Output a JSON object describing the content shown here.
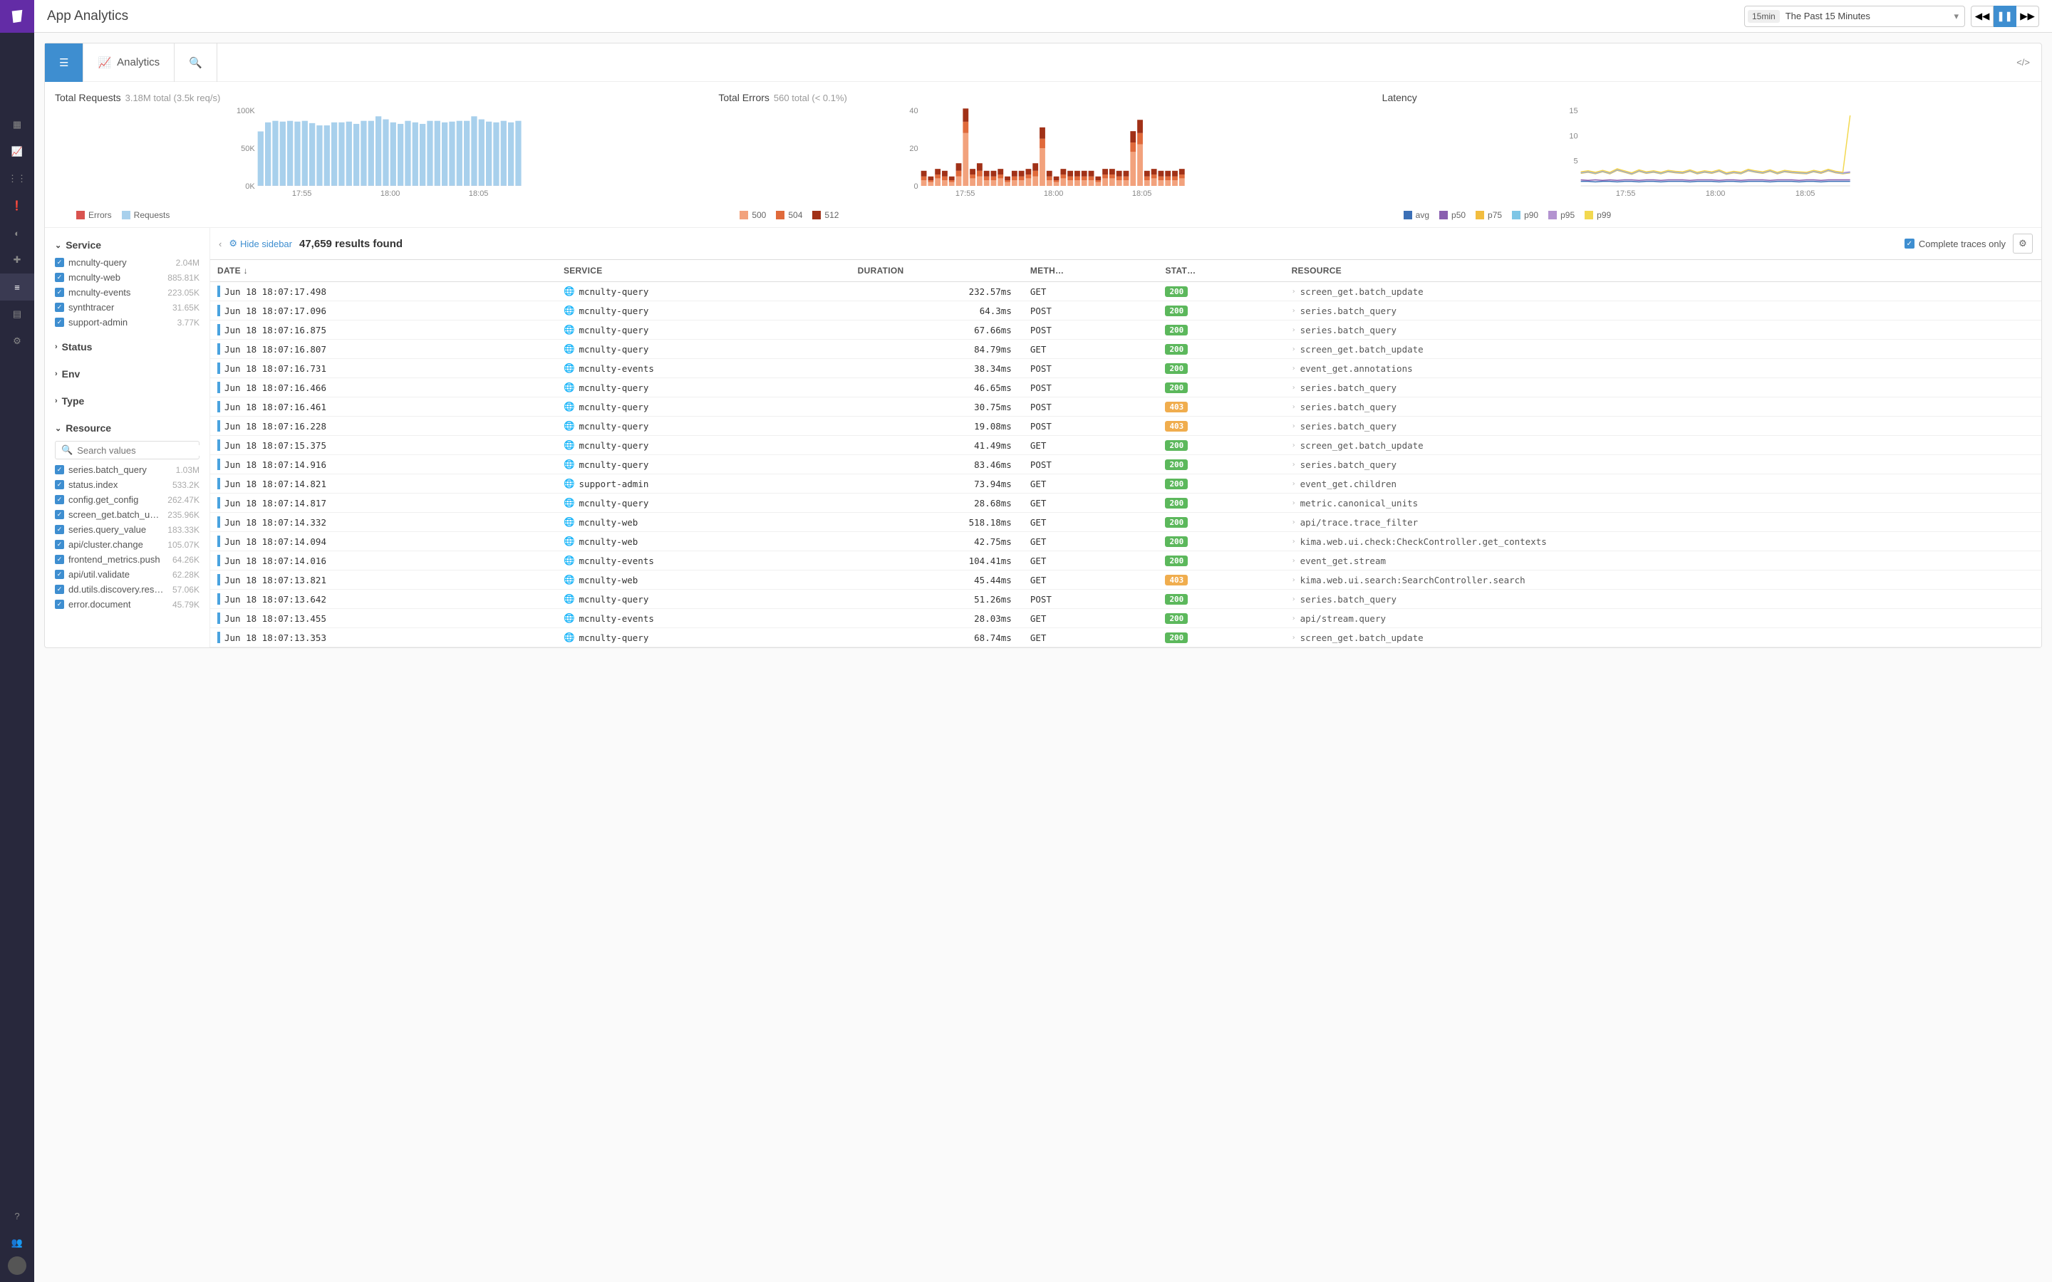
{
  "header": {
    "title": "App Analytics",
    "timerange_badge": "15min",
    "timerange_label": "The Past 15 Minutes"
  },
  "toolbar": {
    "analytics_label": "Analytics"
  },
  "chart_data": [
    {
      "type": "bar",
      "title": "Total Requests",
      "subtitle": "3.18M total (3.5k req/s)",
      "ylabel": "",
      "ylim": [
        0,
        100000
      ],
      "yticks": [
        0,
        50000,
        100000
      ],
      "ytick_labels": [
        "0K",
        "50K",
        "100K"
      ],
      "xticks": [
        "17:55",
        "18:00",
        "18:05"
      ],
      "series": [
        {
          "name": "Errors",
          "color": "#d9534f",
          "values": [
            150,
            140,
            150,
            150,
            140,
            150,
            150,
            140,
            140,
            140,
            150,
            150,
            150,
            140,
            150,
            150,
            160,
            150,
            150,
            140,
            150,
            150,
            140,
            150,
            150,
            140,
            150,
            150,
            150,
            160,
            150,
            150,
            140,
            150,
            150,
            150
          ]
        },
        {
          "name": "Requests",
          "color": "#a8d0ec",
          "values": [
            72000,
            84000,
            86000,
            85000,
            86000,
            85000,
            86000,
            83000,
            80000,
            80000,
            84000,
            84000,
            85000,
            82000,
            86000,
            86000,
            92000,
            88000,
            84000,
            82000,
            86000,
            84000,
            82000,
            86000,
            86000,
            84000,
            85000,
            86000,
            86000,
            92000,
            88000,
            85000,
            84000,
            86000,
            84000,
            86000
          ]
        }
      ],
      "legend": [
        "Errors",
        "Requests"
      ]
    },
    {
      "type": "bar",
      "title": "Total Errors",
      "subtitle": "560 total (< 0.1%)",
      "ylim": [
        0,
        40
      ],
      "yticks": [
        0,
        20,
        40
      ],
      "ytick_labels": [
        "0",
        "20",
        "40"
      ],
      "xticks": [
        "17:55",
        "18:00",
        "18:05"
      ],
      "series": [
        {
          "name": "500",
          "color": "#f2a27d",
          "values": [
            3,
            2,
            4,
            3,
            2,
            5,
            28,
            4,
            5,
            3,
            3,
            4,
            2,
            3,
            3,
            4,
            5,
            20,
            3,
            2,
            4,
            3,
            3,
            3,
            3,
            2,
            4,
            4,
            3,
            3,
            18,
            22,
            3,
            4,
            3,
            3,
            3,
            4
          ]
        },
        {
          "name": "504",
          "color": "#e06a3b",
          "values": [
            2,
            1,
            2,
            2,
            1,
            3,
            6,
            2,
            3,
            2,
            2,
            2,
            1,
            2,
            2,
            2,
            3,
            5,
            2,
            1,
            2,
            2,
            2,
            2,
            2,
            1,
            2,
            2,
            2,
            2,
            5,
            6,
            2,
            2,
            2,
            2,
            2,
            2
          ]
        },
        {
          "name": "512",
          "color": "#a13117",
          "values": [
            3,
            2,
            3,
            3,
            2,
            4,
            7,
            3,
            4,
            3,
            3,
            3,
            2,
            3,
            3,
            3,
            4,
            6,
            3,
            2,
            3,
            3,
            3,
            3,
            3,
            2,
            3,
            3,
            3,
            3,
            6,
            7,
            3,
            3,
            3,
            3,
            3,
            3
          ]
        }
      ],
      "legend": [
        "500",
        "504",
        "512"
      ]
    },
    {
      "type": "line",
      "title": "Latency",
      "subtitle": "",
      "ylim": [
        0,
        15
      ],
      "yticks": [
        5,
        10,
        15
      ],
      "ytick_labels": [
        "5",
        "10",
        "15"
      ],
      "xticks": [
        "17:55",
        "18:00",
        "18:05"
      ],
      "x": [
        0,
        1,
        2,
        3,
        4,
        5,
        6,
        7,
        8,
        9,
        10,
        11,
        12,
        13,
        14,
        15,
        16,
        17,
        18,
        19,
        20,
        21,
        22,
        23,
        24,
        25,
        26,
        27,
        28,
        29,
        30,
        31,
        32,
        33,
        34,
        35,
        36,
        37
      ],
      "series": [
        {
          "name": "avg",
          "color": "#3b6fb6",
          "values": [
            0.9,
            0.9,
            0.8,
            0.9,
            0.9,
            0.8,
            0.9,
            0.9,
            0.8,
            0.9,
            0.9,
            0.8,
            0.9,
            0.9,
            0.9,
            0.8,
            0.9,
            0.9,
            0.9,
            0.8,
            0.9,
            0.9,
            0.8,
            0.9,
            0.9,
            0.9,
            0.8,
            0.9,
            0.9,
            0.9,
            0.8,
            0.9,
            0.9,
            0.8,
            0.9,
            0.9,
            0.9,
            0.9
          ]
        },
        {
          "name": "p50",
          "color": "#8a5fb0",
          "values": [
            1.2,
            1.1,
            1.2,
            1.1,
            1.2,
            1.1,
            1.2,
            1.2,
            1.1,
            1.2,
            1.2,
            1.1,
            1.2,
            1.2,
            1.2,
            1.1,
            1.2,
            1.2,
            1.2,
            1.1,
            1.2,
            1.2,
            1.1,
            1.2,
            1.2,
            1.2,
            1.1,
            1.2,
            1.2,
            1.2,
            1.1,
            1.2,
            1.2,
            1.1,
            1.2,
            1.2,
            1.2,
            1.2
          ]
        },
        {
          "name": "p75",
          "color": "#f2bd3f",
          "values": [
            2.5,
            2.7,
            2.4,
            2.8,
            2.4,
            3.1,
            2.7,
            2.3,
            2.9,
            2.5,
            2.7,
            2.4,
            2.8,
            2.6,
            2.5,
            2.9,
            2.4,
            2.7,
            2.5,
            2.9,
            2.3,
            2.6,
            2.4,
            3.0,
            2.7,
            2.5,
            2.9,
            2.4,
            2.8,
            2.6,
            2.5,
            2.4,
            2.8,
            2.5,
            3.0,
            2.6,
            2.4,
            2.6
          ]
        },
        {
          "name": "p90",
          "color": "#7ec6e6",
          "values": [
            2.6,
            2.8,
            2.5,
            2.9,
            2.5,
            3.2,
            2.8,
            2.4,
            3.0,
            2.6,
            2.8,
            2.5,
            2.9,
            2.7,
            2.6,
            3.0,
            2.5,
            2.8,
            2.6,
            3.0,
            2.4,
            2.7,
            2.5,
            3.1,
            2.8,
            2.6,
            3.0,
            2.5,
            2.9,
            2.7,
            2.6,
            2.5,
            2.9,
            2.6,
            3.1,
            2.7,
            2.5,
            2.7
          ]
        },
        {
          "name": "p95",
          "color": "#b393d0",
          "values": [
            2.7,
            2.9,
            2.6,
            3.0,
            2.6,
            3.3,
            2.9,
            2.5,
            3.1,
            2.7,
            2.9,
            2.6,
            3.0,
            2.8,
            2.7,
            3.1,
            2.6,
            2.9,
            2.7,
            3.1,
            2.5,
            2.8,
            2.6,
            3.2,
            2.9,
            2.7,
            3.1,
            2.6,
            3.0,
            2.8,
            2.7,
            2.6,
            3.0,
            2.7,
            3.2,
            2.8,
            2.6,
            2.8
          ]
        },
        {
          "name": "p99",
          "color": "#f2d84f",
          "values": [
            2.8,
            3.0,
            2.7,
            3.1,
            2.7,
            3.4,
            3.0,
            2.6,
            3.2,
            2.8,
            3.0,
            2.7,
            3.1,
            2.9,
            2.8,
            3.2,
            2.7,
            3.0,
            2.8,
            3.2,
            2.6,
            2.9,
            2.7,
            3.3,
            3.0,
            2.8,
            3.2,
            2.7,
            3.1,
            2.9,
            2.8,
            2.7,
            3.1,
            2.8,
            3.3,
            2.9,
            2.7,
            14.0
          ]
        }
      ],
      "legend": [
        "avg",
        "p50",
        "p75",
        "p90",
        "p95",
        "p99"
      ]
    }
  ],
  "facets": {
    "service": {
      "label": "Service",
      "expanded": true,
      "items": [
        {
          "name": "mcnulty-query",
          "count": "2.04M"
        },
        {
          "name": "mcnulty-web",
          "count": "885.81K"
        },
        {
          "name": "mcnulty-events",
          "count": "223.05K"
        },
        {
          "name": "synthtracer",
          "count": "31.65K"
        },
        {
          "name": "support-admin",
          "count": "3.77K"
        }
      ]
    },
    "status": {
      "label": "Status",
      "expanded": false
    },
    "env": {
      "label": "Env",
      "expanded": false
    },
    "type": {
      "label": "Type",
      "expanded": false
    },
    "resource": {
      "label": "Resource",
      "expanded": true,
      "search_placeholder": "Search values",
      "items": [
        {
          "name": "series.batch_query",
          "count": "1.03M"
        },
        {
          "name": "status.index",
          "count": "533.2K"
        },
        {
          "name": "config.get_config",
          "count": "262.47K"
        },
        {
          "name": "screen_get.batch_update",
          "count": "235.96K"
        },
        {
          "name": "series.query_value",
          "count": "183.33K"
        },
        {
          "name": "api/cluster.change",
          "count": "105.07K"
        },
        {
          "name": "frontend_metrics.push",
          "count": "64.26K"
        },
        {
          "name": "api/util.validate",
          "count": "62.28K"
        },
        {
          "name": "dd.utils.discovery.resolv…",
          "count": "57.06K"
        },
        {
          "name": "error.document",
          "count": "45.79K"
        }
      ]
    }
  },
  "results": {
    "hide_label": "Hide sidebar",
    "count_label": "47,659 results found",
    "complete_label": "Complete traces only",
    "columns": [
      "DATE",
      "SERVICE",
      "DURATION",
      "METH…",
      "STAT…",
      "RESOURCE"
    ],
    "rows": [
      {
        "date": "Jun 18 18:07:17.498",
        "service": "mcnulty-query",
        "duration": "232.57ms",
        "method": "GET",
        "status": "200",
        "resource": "screen_get.batch_update"
      },
      {
        "date": "Jun 18 18:07:17.096",
        "service": "mcnulty-query",
        "duration": "64.3ms",
        "method": "POST",
        "status": "200",
        "resource": "series.batch_query"
      },
      {
        "date": "Jun 18 18:07:16.875",
        "service": "mcnulty-query",
        "duration": "67.66ms",
        "method": "POST",
        "status": "200",
        "resource": "series.batch_query"
      },
      {
        "date": "Jun 18 18:07:16.807",
        "service": "mcnulty-query",
        "duration": "84.79ms",
        "method": "GET",
        "status": "200",
        "resource": "screen_get.batch_update"
      },
      {
        "date": "Jun 18 18:07:16.731",
        "service": "mcnulty-events",
        "duration": "38.34ms",
        "method": "POST",
        "status": "200",
        "resource": "event_get.annotations"
      },
      {
        "date": "Jun 18 18:07:16.466",
        "service": "mcnulty-query",
        "duration": "46.65ms",
        "method": "POST",
        "status": "200",
        "resource": "series.batch_query"
      },
      {
        "date": "Jun 18 18:07:16.461",
        "service": "mcnulty-query",
        "duration": "30.75ms",
        "method": "POST",
        "status": "403",
        "resource": "series.batch_query"
      },
      {
        "date": "Jun 18 18:07:16.228",
        "service": "mcnulty-query",
        "duration": "19.08ms",
        "method": "POST",
        "status": "403",
        "resource": "series.batch_query"
      },
      {
        "date": "Jun 18 18:07:15.375",
        "service": "mcnulty-query",
        "duration": "41.49ms",
        "method": "GET",
        "status": "200",
        "resource": "screen_get.batch_update"
      },
      {
        "date": "Jun 18 18:07:14.916",
        "service": "mcnulty-query",
        "duration": "83.46ms",
        "method": "POST",
        "status": "200",
        "resource": "series.batch_query"
      },
      {
        "date": "Jun 18 18:07:14.821",
        "service": "support-admin",
        "duration": "73.94ms",
        "method": "GET",
        "status": "200",
        "resource": "event_get.children"
      },
      {
        "date": "Jun 18 18:07:14.817",
        "service": "mcnulty-query",
        "duration": "28.68ms",
        "method": "GET",
        "status": "200",
        "resource": "metric.canonical_units"
      },
      {
        "date": "Jun 18 18:07:14.332",
        "service": "mcnulty-web",
        "duration": "518.18ms",
        "method": "GET",
        "status": "200",
        "resource": "api/trace.trace_filter"
      },
      {
        "date": "Jun 18 18:07:14.094",
        "service": "mcnulty-web",
        "duration": "42.75ms",
        "method": "GET",
        "status": "200",
        "resource": "kima.web.ui.check:CheckController.get_contexts"
      },
      {
        "date": "Jun 18 18:07:14.016",
        "service": "mcnulty-events",
        "duration": "104.41ms",
        "method": "GET",
        "status": "200",
        "resource": "event_get.stream"
      },
      {
        "date": "Jun 18 18:07:13.821",
        "service": "mcnulty-web",
        "duration": "45.44ms",
        "method": "GET",
        "status": "403",
        "resource": "kima.web.ui.search:SearchController.search"
      },
      {
        "date": "Jun 18 18:07:13.642",
        "service": "mcnulty-query",
        "duration": "51.26ms",
        "method": "POST",
        "status": "200",
        "resource": "series.batch_query"
      },
      {
        "date": "Jun 18 18:07:13.455",
        "service": "mcnulty-events",
        "duration": "28.03ms",
        "method": "GET",
        "status": "200",
        "resource": "api/stream.query"
      },
      {
        "date": "Jun 18 18:07:13.353",
        "service": "mcnulty-query",
        "duration": "68.74ms",
        "method": "GET",
        "status": "200",
        "resource": "screen_get.batch_update"
      }
    ]
  }
}
